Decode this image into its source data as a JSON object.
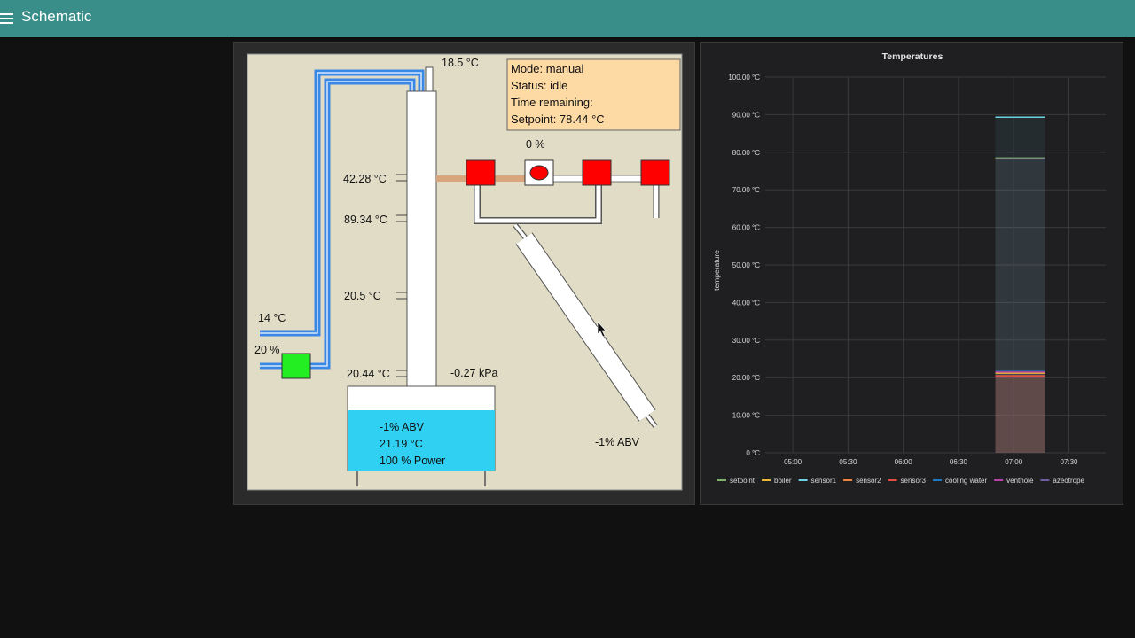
{
  "app": {
    "title": "Schematic",
    "menu_icon": "hamburger-menu-icon"
  },
  "schematic": {
    "info": {
      "mode": "Mode: manual",
      "status": "Status: idle",
      "time_remaining": "Time remaining:",
      "setpoint": "Setpoint: 78.44 °C"
    },
    "labels": {
      "top_temp": "18.5 °C",
      "valve_percent": "0 %",
      "column_t1": "42.28 °C",
      "column_t2": "89.34 °C",
      "column_t3": "20.5 °C",
      "column_t4": "20.44 °C",
      "cooling_temp": "14 °C",
      "pump_percent": "20 %",
      "pressure": "-0.27 kPa",
      "output_abv": "-1% ABV"
    },
    "boiler": {
      "abv": "-1% ABV",
      "temp": "21.19 °C",
      "power": "100 % Power"
    },
    "colors": {
      "background": "#e0dcc5",
      "valve": "#ff0000",
      "pump": "#22ee22",
      "pipe": "#3a88e6",
      "liquid": "#2fd0f2",
      "info_box": "#fdd9a4"
    }
  },
  "chart": {
    "title": "Temperatures",
    "ylabel": "temperature",
    "ytick_labels": [
      "0 °C",
      "10.00 °C",
      "20.00 °C",
      "30.00 °C",
      "40.00 °C",
      "50.00 °C",
      "60.00 °C",
      "70.00 °C",
      "80.00 °C",
      "90.00 °C",
      "100.00 °C"
    ],
    "xtick_labels": [
      "05:00",
      "05:30",
      "06:00",
      "06:30",
      "07:00",
      "07:30"
    ]
  },
  "chart_data": {
    "type": "area",
    "title": "Temperatures",
    "xlabel": "",
    "ylabel": "temperature",
    "ylim": [
      0,
      100
    ],
    "x_ticks": [
      "05:00",
      "05:30",
      "06:00",
      "06:30",
      "07:00",
      "07:30"
    ],
    "x_range": [
      "04:45",
      "07:50"
    ],
    "data_x_range": [
      "06:50",
      "07:17"
    ],
    "grid": true,
    "legend_position": "bottom",
    "series": [
      {
        "name": "setpoint",
        "color": "#7eb26d",
        "value": 78.44
      },
      {
        "name": "boiler",
        "color": "#eab839",
        "value": 21.19
      },
      {
        "name": "sensor1",
        "color": "#6ed0e0",
        "value": 89.34
      },
      {
        "name": "sensor2",
        "color": "#ef843c",
        "value": 20.5
      },
      {
        "name": "sensor3",
        "color": "#e24d42",
        "value": 20.44
      },
      {
        "name": "cooling water",
        "color": "#1f78c1",
        "value": 22.0
      },
      {
        "name": "venthole",
        "color": "#ba43a9",
        "value": 21.5
      },
      {
        "name": "azeotrope",
        "color": "#705da0",
        "value": 78.2
      }
    ]
  }
}
